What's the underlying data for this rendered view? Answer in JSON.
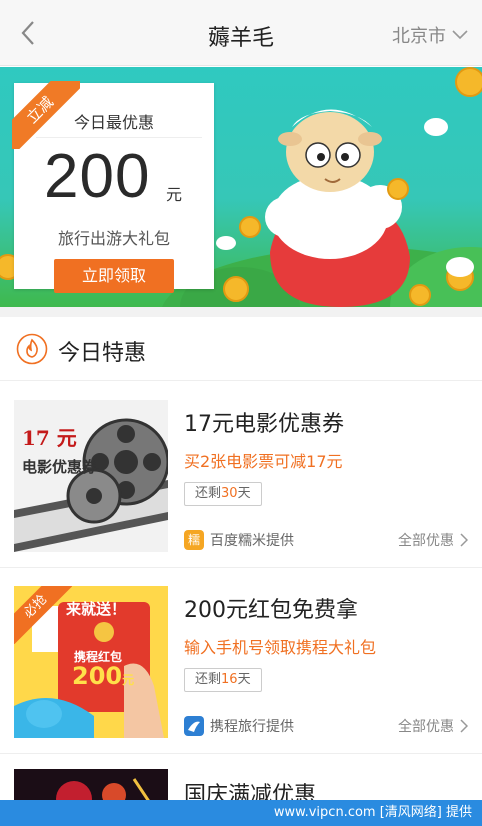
{
  "nav": {
    "title": "薅羊毛",
    "city": "北京市"
  },
  "banner": {
    "tag": "立减",
    "card_title": "今日最优惠",
    "amount": "200",
    "unit": "元",
    "subtitle": "旅行出游大礼包",
    "button": "立即领取"
  },
  "section": {
    "title": "今日特惠"
  },
  "deals": [
    {
      "title": "17元电影优惠券",
      "subtitle": "买2张电影票可减17元",
      "remain_prefix": "还剩",
      "remain_days": "30",
      "remain_suffix": "天",
      "provider": "百度糯米提供",
      "all_label": "全部优惠",
      "thumb_text_top": "17 元",
      "thumb_text_bottom": "电影优惠券",
      "logo_text": "糯"
    },
    {
      "title": "200元红包免费拿",
      "subtitle": "输入手机号领取携程大礼包",
      "remain_prefix": "还剩",
      "remain_days": "16",
      "remain_suffix": "天",
      "provider": "携程旅行提供",
      "all_label": "全部优惠",
      "badge": "必抢",
      "thumb_text_top": "来就送！",
      "thumb_text_mid": "携程红包",
      "thumb_amount": "200",
      "thumb_unit": "元"
    },
    {
      "title": "国庆满减优惠"
    }
  ],
  "watermark": "www.vipcn.com [清风网络] 提供",
  "colors": {
    "accent": "#f07022",
    "banner_sky": "#2fc9c0",
    "grass": "#3fb94e"
  },
  "icons": [
    "back-arrow-icon",
    "chevron-down-icon",
    "fire-icon",
    "chevron-right-icon"
  ]
}
